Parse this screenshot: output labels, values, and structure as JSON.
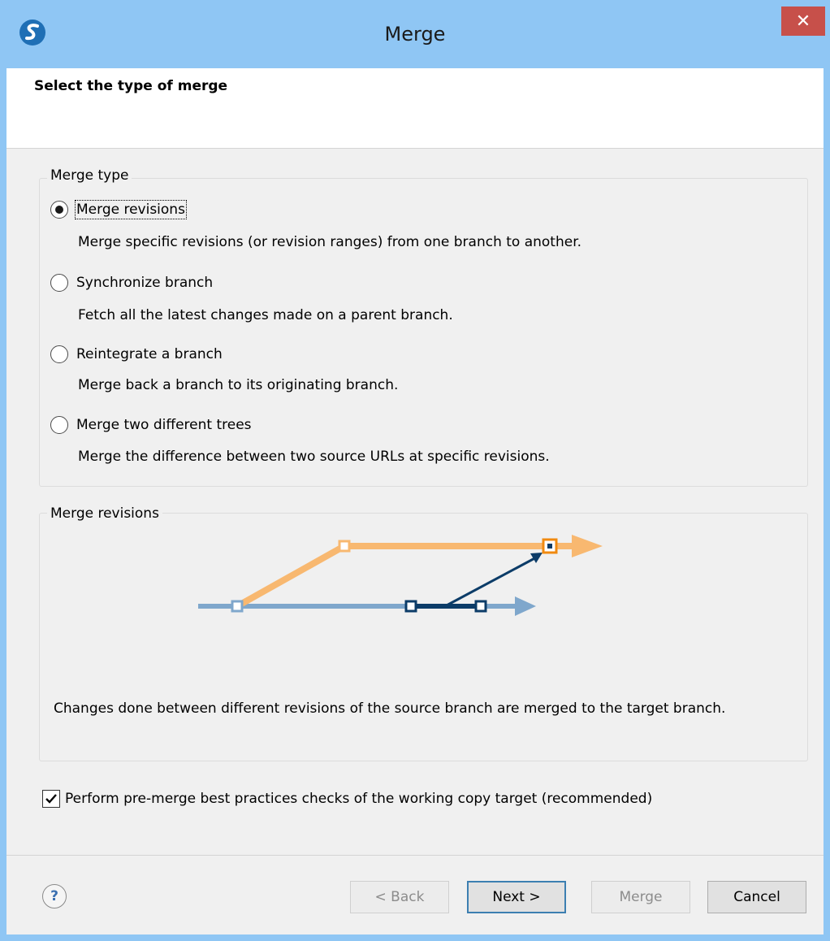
{
  "window": {
    "title": "Merge",
    "close_label": "✕"
  },
  "header": {
    "title": "Select the type of merge"
  },
  "merge_type_group": {
    "legend": "Merge type",
    "options": [
      {
        "label": "Merge revisions",
        "description": "Merge specific revisions (or revision ranges) from one branch to another.",
        "selected": true
      },
      {
        "label": "Synchronize branch",
        "description": "Fetch all the latest changes made on a parent branch.",
        "selected": false
      },
      {
        "label": "Reintegrate a branch",
        "description": "Merge back a branch to its originating branch.",
        "selected": false
      },
      {
        "label": "Merge two different trees",
        "description": "Merge the difference between two source URLs at specific revisions.",
        "selected": false
      }
    ]
  },
  "diagram_group": {
    "legend": "Merge revisions",
    "description": "Changes done between different revisions of the source branch are merged to the target branch.",
    "colors": {
      "target_branch": "#f8b870",
      "source_branch": "#7fa7cc",
      "merged_range": "#0c3c68"
    }
  },
  "precheck": {
    "label": "Perform pre-merge best practices checks of the working copy target (recommended)",
    "checked": true
  },
  "buttons": {
    "help": "?",
    "back": "< Back",
    "next": "Next >",
    "merge": "Merge",
    "cancel": "Cancel"
  }
}
